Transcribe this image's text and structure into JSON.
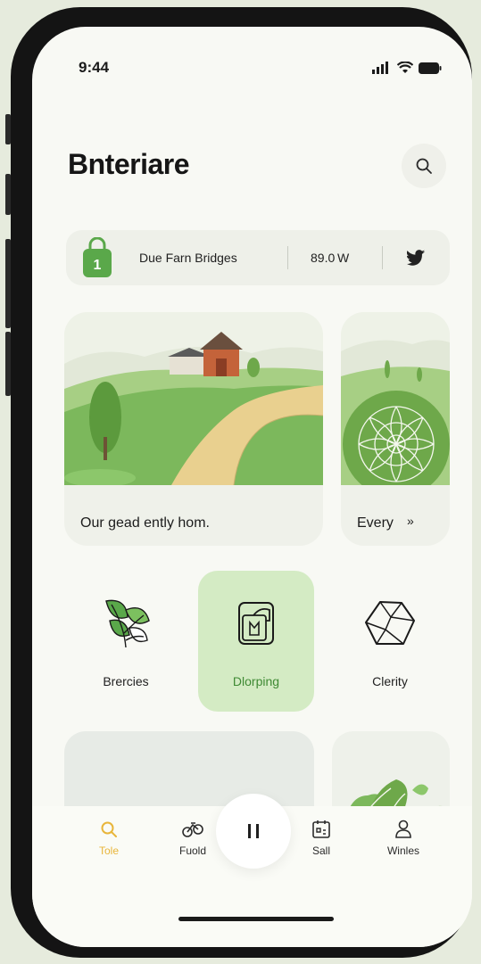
{
  "status_bar": {
    "time": "9:44"
  },
  "header": {
    "title": "Bnteriare"
  },
  "info_bar": {
    "badge_number": "1",
    "text": "Due Farn Bridges",
    "value": "89.0 W"
  },
  "featured": [
    {
      "caption": "Our gead ently hom."
    },
    {
      "caption": "Every",
      "arrow": "»"
    }
  ],
  "categories": [
    {
      "label": "Brercies",
      "icon": "leaf-icon",
      "active": false
    },
    {
      "label": "Dlorping",
      "icon": "package-icon",
      "active": true
    },
    {
      "label": "Clerity",
      "icon": "polyhedron-icon",
      "active": false
    }
  ],
  "tabs": [
    {
      "label": "Tole",
      "icon": "search-icon",
      "active": true
    },
    {
      "label": "Fuold",
      "icon": "bike-icon",
      "active": false
    },
    {
      "label": "Sall",
      "icon": "calendar-icon",
      "active": false
    },
    {
      "label": "Winles",
      "icon": "person-icon",
      "active": false
    }
  ],
  "colors": {
    "accent_green": "#5aa84a",
    "active_tab": "#e8b53a",
    "active_card": "#d4ebc4"
  }
}
